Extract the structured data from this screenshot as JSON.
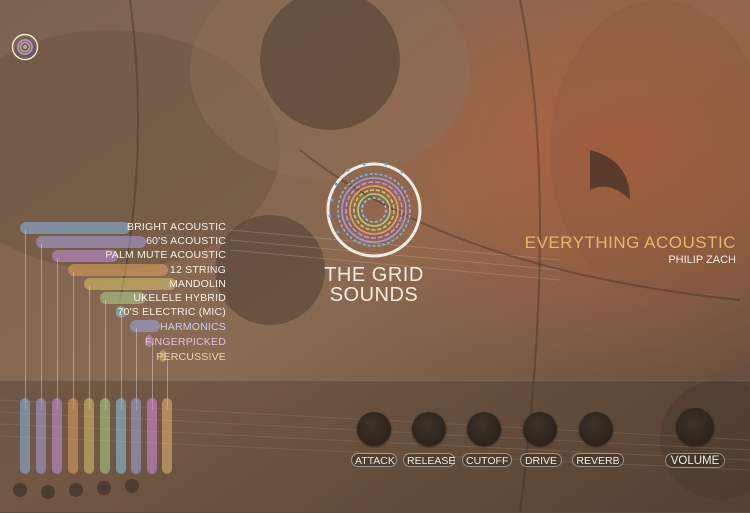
{
  "instrument": {
    "brand_line1": "THE GRID",
    "brand_line2": "SOUNDS",
    "title": "EVERYTHING ACOUSTIC",
    "author": "PHILIP ZACH"
  },
  "presets": [
    {
      "label": "BRIGHT ACOUSTIC",
      "color": "#8ab4e8"
    },
    {
      "label": "60'S ACOUSTIC",
      "color": "#a89ee0"
    },
    {
      "label": "PALM MUTE ACOUSTIC",
      "color": "#c48fe6"
    },
    {
      "label": "12 STRING",
      "color": "#e0a05a"
    },
    {
      "label": "MANDOLIN",
      "color": "#d6c46a"
    },
    {
      "label": "UKELELE HYBRID",
      "color": "#a9d48a"
    },
    {
      "label": "70'S ELECTRIC (MIC)",
      "color": "#86c6e6"
    },
    {
      "label": "HARMONICS",
      "color": "#9aa8e8"
    },
    {
      "label": "FINGERPICKED",
      "color": "#d28ee0"
    },
    {
      "label": "PERCUSSIVE",
      "color": "#e4b870"
    }
  ],
  "controls": {
    "attack": "ATTACK",
    "release": "RELEASE",
    "cutoff": "CUTOFF",
    "drive": "DRIVE",
    "reverb": "REVERB",
    "volume": "VOLUME"
  },
  "colors": {
    "accent": "#e7b66a",
    "text": "#f3ece2"
  }
}
